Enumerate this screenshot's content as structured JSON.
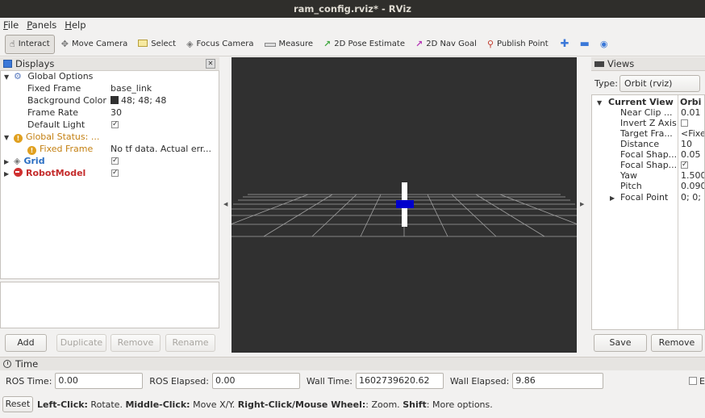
{
  "window": {
    "title": "ram_config.rviz* - RViz"
  },
  "menu": {
    "items": [
      "File",
      "Panels",
      "Help"
    ]
  },
  "toolbar": {
    "tools": [
      {
        "label": "Interact",
        "icon": "interact-icon",
        "active": true
      },
      {
        "label": "Move Camera",
        "icon": "move-camera-icon",
        "active": false
      },
      {
        "label": "Select",
        "icon": "select-icon",
        "active": false
      },
      {
        "label": "Focus Camera",
        "icon": "focus-camera-icon",
        "active": false
      },
      {
        "label": "Measure",
        "icon": "measure-icon",
        "active": false
      },
      {
        "label": "2D Pose Estimate",
        "icon": "pose-estimate-icon",
        "active": false
      },
      {
        "label": "2D Nav Goal",
        "icon": "nav-goal-icon",
        "active": false
      },
      {
        "label": "Publish Point",
        "icon": "publish-point-icon",
        "active": false
      }
    ],
    "extra_icons": [
      "add-tool-icon",
      "remove-tool-icon",
      "camera-type-icon"
    ]
  },
  "displays": {
    "title": "Displays",
    "global_options": {
      "label": "Global Options",
      "fixed_frame": {
        "label": "Fixed Frame",
        "value": "base_link"
      },
      "background_color": {
        "label": "Background Color",
        "value": "48; 48; 48",
        "swatch": "#303030"
      },
      "frame_rate": {
        "label": "Frame Rate",
        "value": "30"
      },
      "default_light": {
        "label": "Default Light",
        "checked": true
      }
    },
    "global_status": {
      "label": "Global Status: ...",
      "fixed_frame": {
        "label": "Fixed Frame",
        "value": "No tf data.  Actual err..."
      },
      "color": "#c37f10"
    },
    "grid": {
      "label": "Grid",
      "checked": true,
      "color": "#2b6fc3"
    },
    "robot_model": {
      "label": "RobotModel",
      "checked": true,
      "color": "#c42c2c"
    },
    "buttons": {
      "add": "Add",
      "duplicate": "Duplicate",
      "remove": "Remove",
      "rename": "Rename"
    }
  },
  "views": {
    "title": "Views",
    "type_label": "Type:",
    "type_value": "Orbit (rviz)",
    "current_view": {
      "label": "Current View",
      "value": "Orbi"
    },
    "props": [
      {
        "label": "Near Clip ...",
        "value": "0.01"
      },
      {
        "label": "Invert Z Axis",
        "checkbox": true,
        "checked": false
      },
      {
        "label": "Target Fra...",
        "value": "<Fixe"
      },
      {
        "label": "Distance",
        "value": "10"
      },
      {
        "label": "Focal Shap...",
        "value": "0.05"
      },
      {
        "label": "Focal Shap...",
        "checkbox": true,
        "checked": true
      },
      {
        "label": "Yaw",
        "value": "1.500"
      },
      {
        "label": "Pitch",
        "value": "0.090"
      }
    ],
    "focal_point": {
      "label": "Focal Point",
      "value": "0; 0;"
    },
    "buttons": {
      "save": "Save",
      "remove": "Remove"
    }
  },
  "time": {
    "title": "Time",
    "ros_time": {
      "label": "ROS Time:",
      "value": "0.00"
    },
    "ros_elapsed": {
      "label": "ROS Elapsed:",
      "value": "0.00"
    },
    "wall_time": {
      "label": "Wall Time:",
      "value": "1602739620.62"
    },
    "wall_elapsed": {
      "label": "Wall Elapsed:",
      "value": "9.86"
    },
    "experimental_label": "E"
  },
  "statusbar": {
    "reset": "Reset",
    "left_click": "Left-Click:",
    "left_click_desc": " Rotate. ",
    "middle_click": "Middle-Click:",
    "middle_click_desc": " Move X/Y. ",
    "right_click": "Right-Click/Mouse Wheel:",
    "right_click_desc": ": Zoom. ",
    "shift": "Shift",
    "shift_desc": ": More options."
  },
  "colors": {
    "viewport_bg": "#303030",
    "grid_line": "#a0a0a0",
    "robot_body": "#ffffff",
    "robot_base": "#0000cc"
  }
}
